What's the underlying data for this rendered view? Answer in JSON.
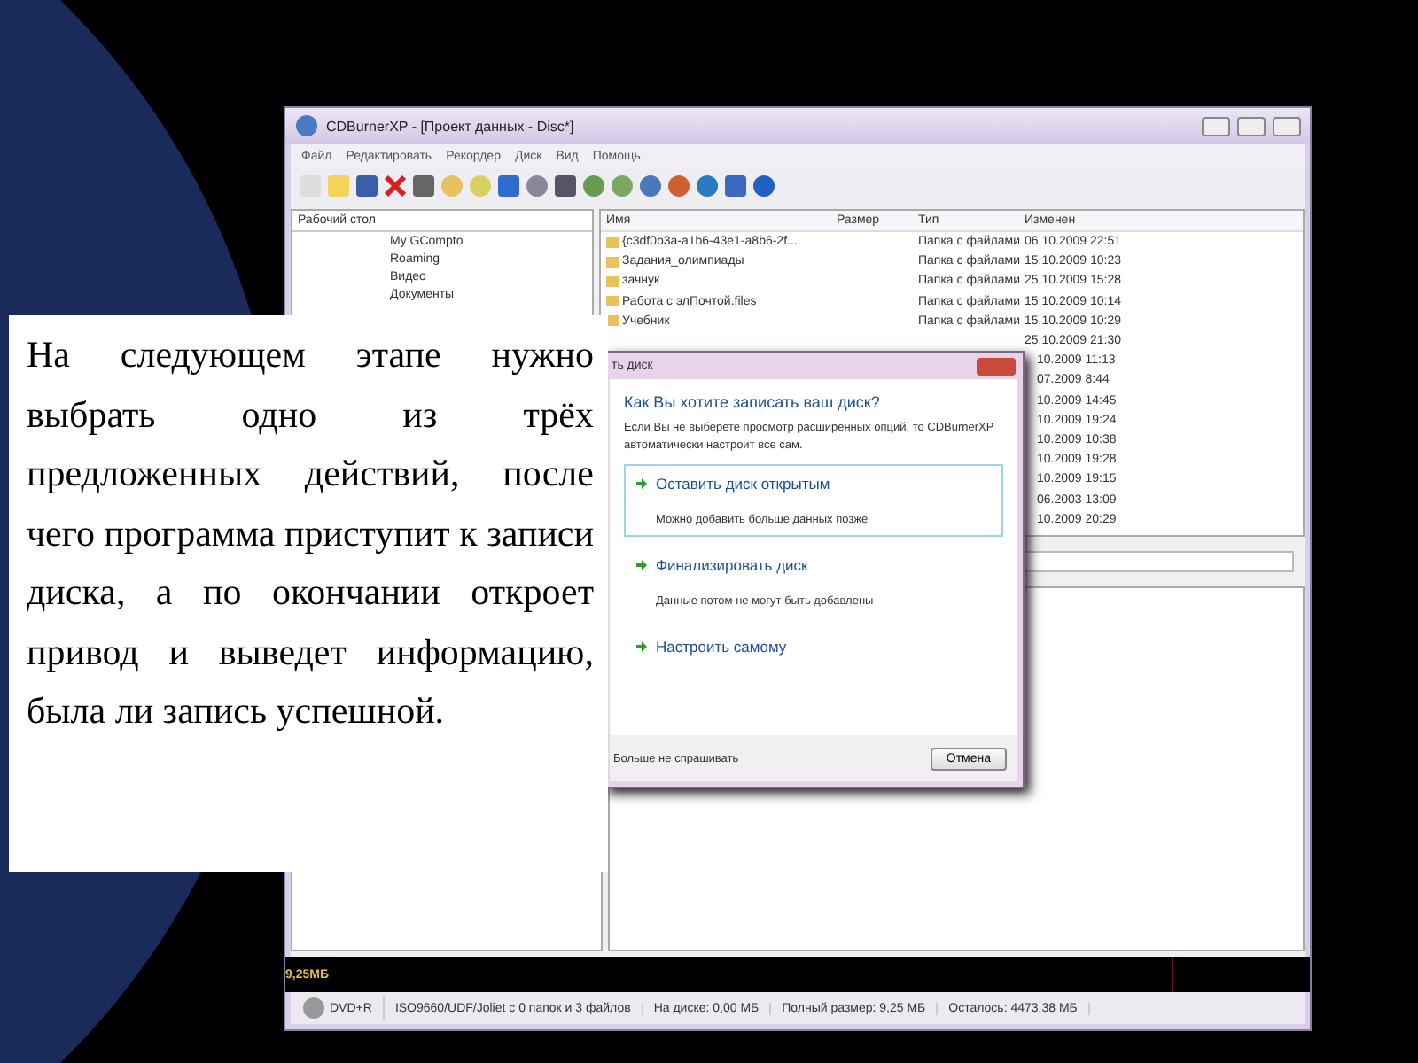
{
  "window": {
    "title": "CDBurnerXP - [Проект данных - Disc*]"
  },
  "menu": [
    "Файл",
    "Редактировать",
    "Рекордер",
    "Диск",
    "Вид",
    "Помощь"
  ],
  "tree": {
    "location": "Рабочий стол",
    "items": [
      "My GCompto",
      "Roaming",
      "Видео",
      "Документы"
    ]
  },
  "file_list": {
    "columns": [
      "Имя",
      "Размер",
      "Тип",
      "Изменен"
    ],
    "rows": [
      {
        "name": "{c3df0b3a-a1b6-43e1-a8b6-2f...",
        "type": "Папка с файлами",
        "modified": "06.10.2009 22:51"
      },
      {
        "name": "Задания_олимпиады",
        "type": "Папка с файлами",
        "modified": "15.10.2009 10:23"
      },
      {
        "name": "зачнук",
        "type": "Папка с файлами",
        "modified": "25.10.2009 15:28"
      },
      {
        "name": "Работа с элПочтой.files",
        "type": "Папка с файлами",
        "modified": "15.10.2009 10:14"
      },
      {
        "name": "Учебник",
        "type": "Папка с файлами",
        "modified": "15.10.2009 10:29"
      },
      {
        "modified": "25.10.2009 21:30"
      },
      {
        "modified": "10.2009 11:13"
      },
      {
        "modified": "07.2009 8:44"
      },
      {
        "modified": "10.2009 14:45"
      },
      {
        "modified": "10.2009 19:24"
      },
      {
        "modified": "10.2009 10:38"
      },
      {
        "modified": "10.2009 19:28"
      },
      {
        "modified": "10.2009 19:15"
      },
      {
        "modified": "06.2003 13:09"
      },
      {
        "modified": "10.2009 20:29"
      }
    ]
  },
  "size_bar": {
    "label": "9,25МБ"
  },
  "status_bar": [
    "DVD+R",
    "ISO9660/UDF/Joliet с 0 папок и 3 файлов",
    "На диске: 0,00 МБ",
    "Полный размер: 9,25 МБ",
    "Осталось: 4473,38 МБ"
  ],
  "dialog": {
    "title": "ть диск",
    "heading": "Как Вы хотите записать ваш диск?",
    "description": "Если Вы не выберете просмотр расширенных опций, то CDBurnerXP автоматически настроит все сам.",
    "options": [
      {
        "label": "Оставить диск открытым",
        "note": "Можно добавить больше данных позже",
        "selected": true
      },
      {
        "label": "Финализировать диск",
        "note": "Данные потом не могут быть добавлены",
        "selected": false
      },
      {
        "label": "Настроить самому",
        "selected": false
      }
    ],
    "dont_ask": "Больше не спрашивать",
    "cancel": "Отмена"
  },
  "slide_text": "На следующем этапе нужно выбрать одно из трёх предложенных действий, после чего программа приступит к записи диска, а по окончании откроет привод и выведет информацию, была ли запись успешной."
}
